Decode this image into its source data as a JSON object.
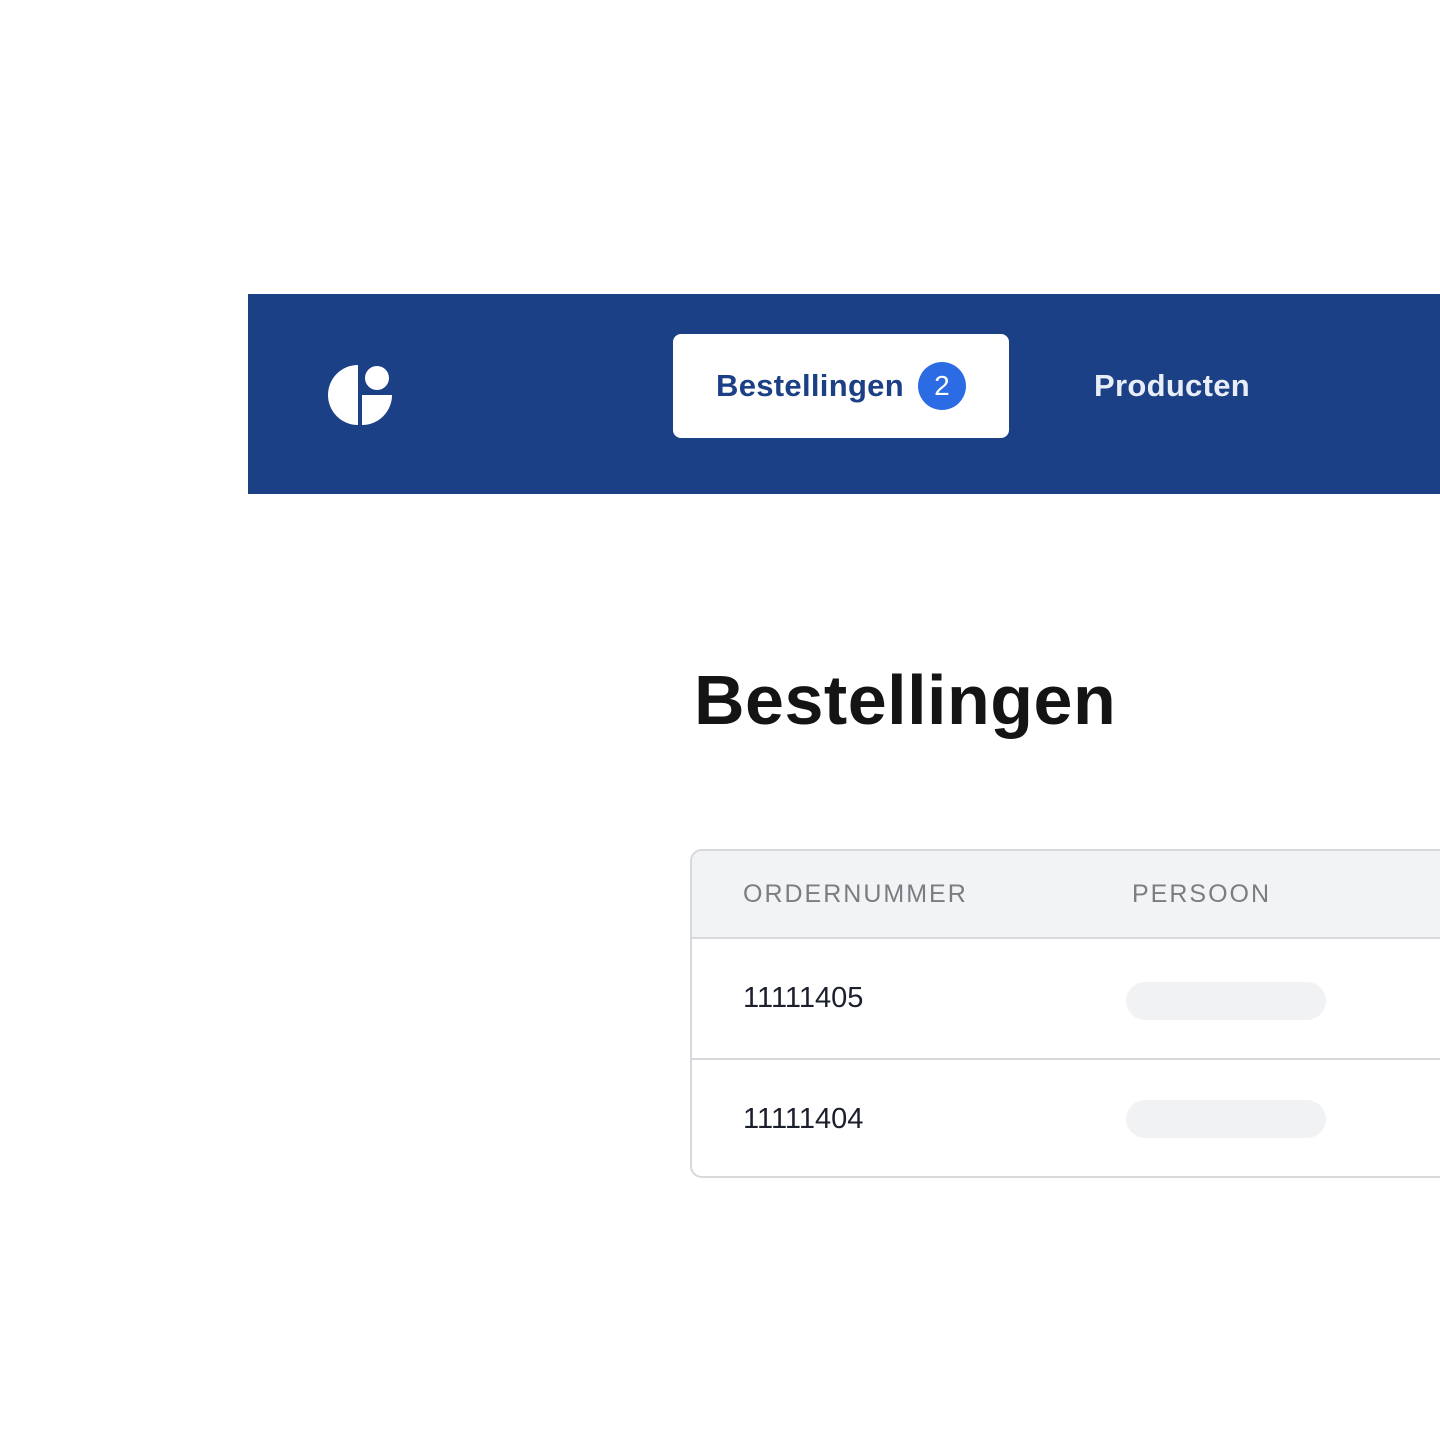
{
  "nav": {
    "logo_icon": "brand-logo-icon",
    "tabs": [
      {
        "label": "Bestellingen",
        "badge": "2",
        "active": true
      },
      {
        "label": "Producten",
        "active": false
      }
    ]
  },
  "main": {
    "title": "Bestellingen",
    "table": {
      "columns": [
        "ORDERNUMMER",
        "PERSOON"
      ],
      "rows": [
        {
          "ordernummer": "11111405",
          "persoon": ""
        },
        {
          "ordernummer": "11111404",
          "persoon": ""
        }
      ]
    }
  },
  "colors": {
    "nav_background": "#1b4086",
    "badge": "#2b6be4",
    "skeleton": "#f1f2f4",
    "table_header": "#f2f3f5"
  }
}
